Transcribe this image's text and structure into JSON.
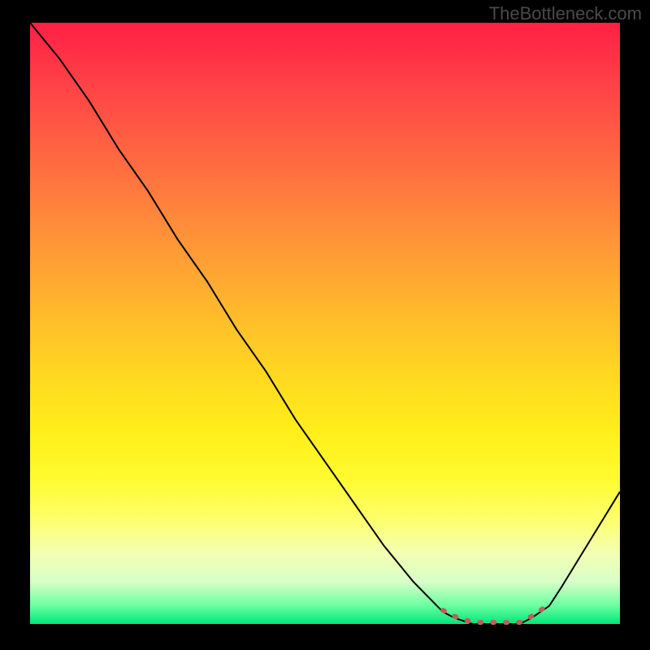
{
  "watermark": "TheBottleneck.com",
  "chart_data": {
    "type": "line",
    "title": "",
    "xlabel": "",
    "ylabel": "",
    "x": [
      0.0,
      0.05,
      0.1,
      0.15,
      0.2,
      0.25,
      0.3,
      0.35,
      0.4,
      0.45,
      0.5,
      0.55,
      0.6,
      0.65,
      0.7,
      0.72,
      0.75,
      0.78,
      0.8,
      0.83,
      0.85,
      0.88,
      0.9,
      0.95,
      1.0
    ],
    "y": [
      1.0,
      0.94,
      0.87,
      0.79,
      0.72,
      0.64,
      0.57,
      0.49,
      0.42,
      0.34,
      0.27,
      0.2,
      0.13,
      0.07,
      0.02,
      0.01,
      0.0,
      0.0,
      0.0,
      0.0,
      0.01,
      0.03,
      0.06,
      0.14,
      0.22
    ],
    "xlim": [
      0,
      1
    ],
    "ylim": [
      0,
      1
    ],
    "highlight_range_x": [
      0.7,
      0.88
    ],
    "annotations": []
  }
}
